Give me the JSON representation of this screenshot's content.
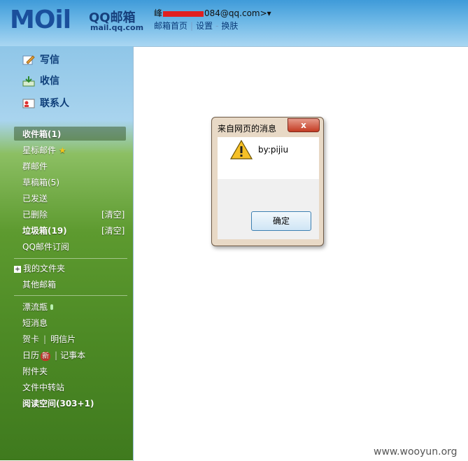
{
  "header": {
    "logo_text": "MOil",
    "brand_cn": "QQ邮箱",
    "brand_url": "mail.qq.com",
    "account_prefix": "峰",
    "account_suffix": "084@qq.com>",
    "account_dropdown": "▾",
    "nav": [
      "邮箱首页",
      "设置",
      "换肤"
    ]
  },
  "sidebar": {
    "actions": [
      {
        "label": "写信",
        "icon": "write-icon"
      },
      {
        "label": "收信",
        "icon": "receive-icon"
      },
      {
        "label": "联系人",
        "icon": "contacts-icon"
      }
    ],
    "folders": {
      "inbox": "收件箱(1)",
      "starred": "星标邮件",
      "group": "群邮件",
      "drafts": "草稿箱(5)",
      "sent": "已发送",
      "deleted": "已删除",
      "spam": "垃圾箱(19)",
      "subscription": "QQ邮件订阅",
      "clear": "[清空]"
    },
    "my_folders": "我的文件夹",
    "other_mailbox": "其他邮箱",
    "tools": {
      "bottle": "漂流瓶",
      "sms": "短消息",
      "card": "贺卡",
      "postcard": "明信片",
      "calendar": "日历",
      "new_badge": "新",
      "notes": "记事本",
      "attachments": "附件夹",
      "transfer": "文件中转站",
      "reading": "阅读空间(303+1)"
    }
  },
  "dialog": {
    "title": "来自网页的消息",
    "close": "x",
    "message": "by:pijiu",
    "ok": "确定"
  },
  "watermark": "www.wooyun.org"
}
